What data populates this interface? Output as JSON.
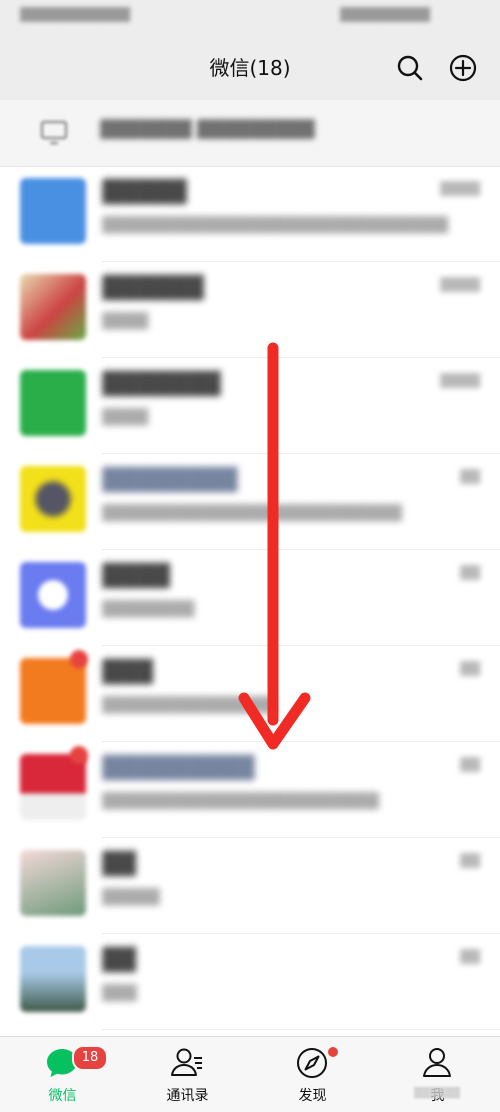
{
  "colors": {
    "brand_green": "#07c160",
    "badge_red": "#e64340",
    "arrow_red": "#f02a24",
    "header_bg": "#ededed"
  },
  "header": {
    "title": "微信(18)",
    "search_icon": "search-icon",
    "add_icon": "plus-circle-icon"
  },
  "tabbar": {
    "tabs": [
      {
        "label": "微信",
        "icon": "chat-bubble-icon",
        "badge": "18",
        "active": true
      },
      {
        "label": "通讯录",
        "icon": "contacts-icon"
      },
      {
        "label": "发现",
        "icon": "compass-icon",
        "dot": true
      },
      {
        "label": "我",
        "icon": "profile-icon"
      }
    ]
  },
  "annotation": {
    "icon": "down-arrow-icon",
    "color": "#f02a24"
  }
}
